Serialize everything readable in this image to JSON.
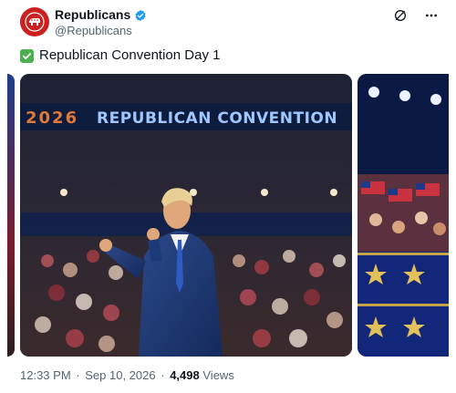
{
  "account": {
    "display_name": "Republicans",
    "handle": "@Republicans",
    "avatar_icon": "elephant-logo-icon",
    "verified_icon": "verified-badge-icon",
    "brand_color": "#cc1f1f"
  },
  "tweet": {
    "text": "Republican Convention Day 1",
    "emoji_icon": "check-mark-button-icon"
  },
  "media": {
    "main_image": {
      "banner_year": "2026",
      "banner_text": "REPUBLICAN CONVENTION",
      "scene": "speaker-at-podium-icon"
    },
    "right_image": {
      "scene": "crowd-with-flags-icon"
    },
    "left_image": {
      "scene": "partial-image-icon"
    }
  },
  "meta": {
    "time": "12:33 PM",
    "separator": "·",
    "date": "Sep 10, 2026",
    "views_count": "4,498",
    "views_label": "Views"
  },
  "colors": {
    "text_primary": "#0f1419",
    "text_secondary": "#536471",
    "verified_blue": "#1d9bf0",
    "check_green": "#4caf50"
  }
}
